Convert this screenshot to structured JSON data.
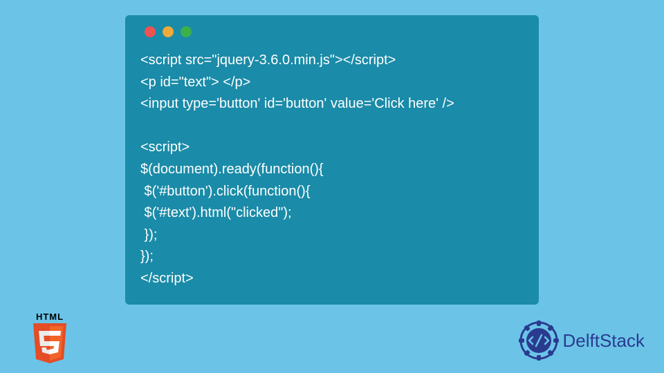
{
  "code": {
    "lines": [
      "<script src=\"jquery-3.6.0.min.js\"></script>",
      "<p id=\"text\"> </p>",
      "<input type='button' id='button' value='Click here' />",
      "",
      "<script>",
      "$(document).ready(function(){",
      " $('#button').click(function(){",
      " $('#text').html(\"clicked\");",
      " });",
      "});",
      "</script>"
    ]
  },
  "html5_badge": {
    "label": "HTML"
  },
  "delftstack": {
    "text": "DelftStack"
  }
}
